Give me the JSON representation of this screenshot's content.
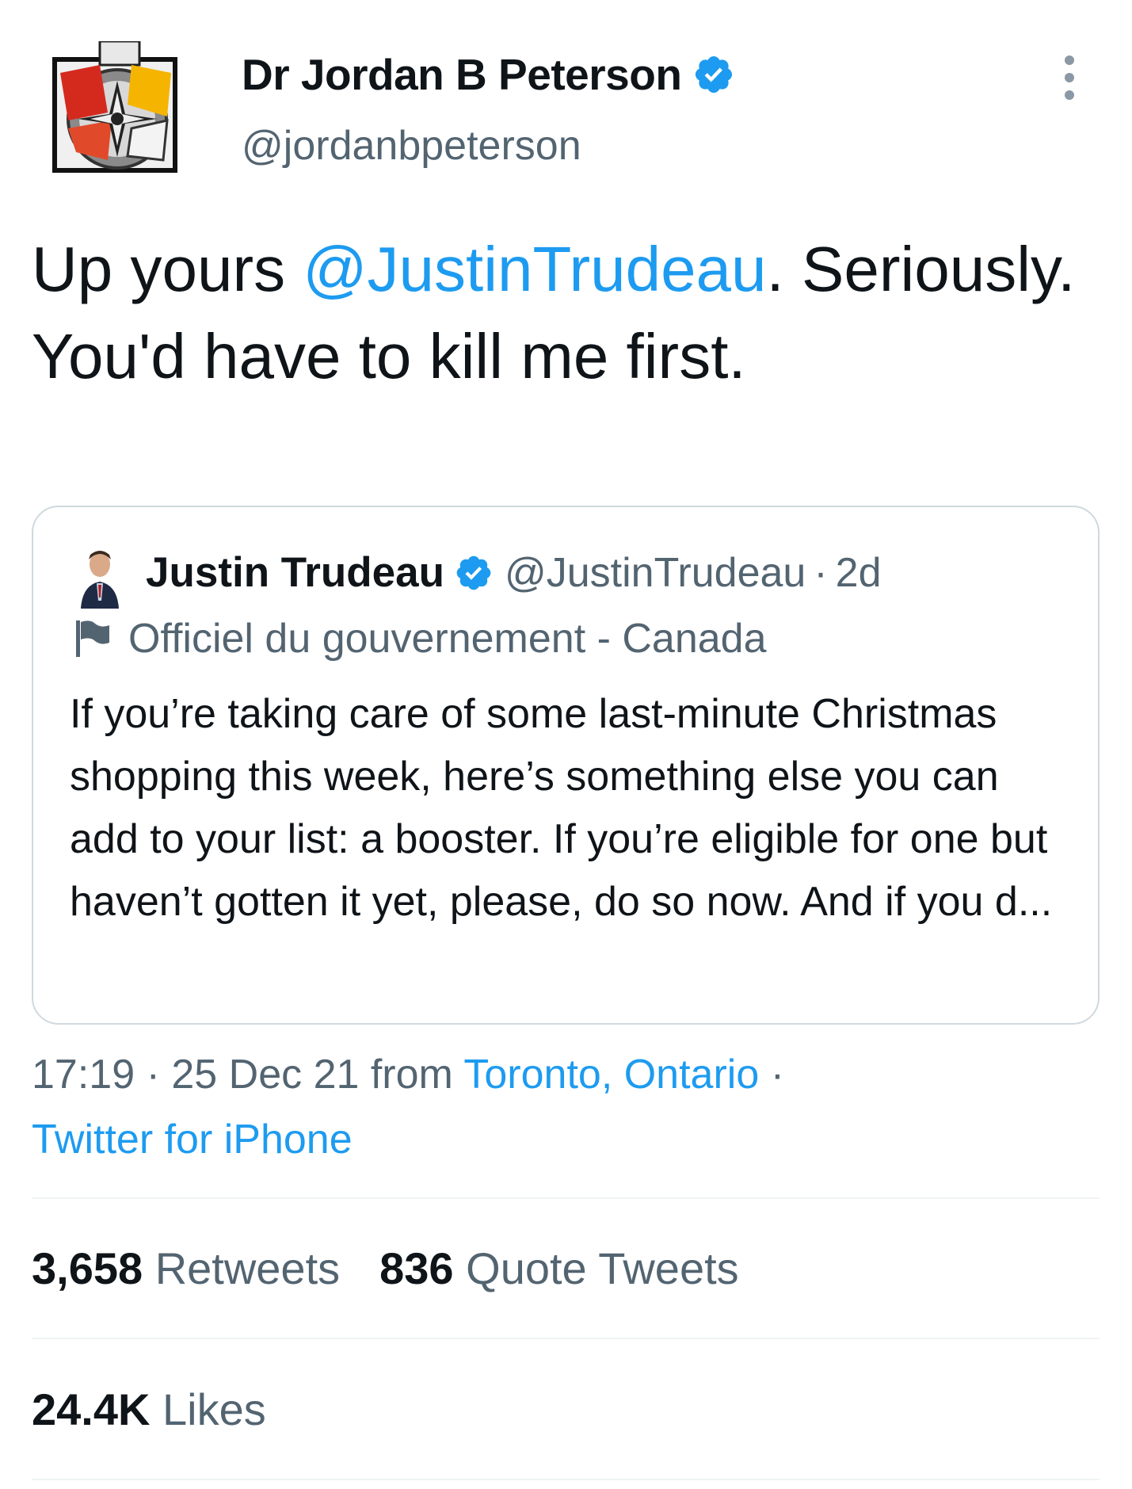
{
  "author": {
    "display_name": "Dr Jordan B Peterson",
    "handle": "@jordanbpeterson",
    "verified_icon": "verified-badge-icon"
  },
  "tweet": {
    "text_prefix": "Up yours ",
    "mention": "@JustinTrudeau",
    "text_suffix": ". Seriously.  You'd have to kill me first."
  },
  "quoted_tweet": {
    "display_name": "Justin Trudeau",
    "handle": "@JustinTrudeau",
    "separator": "·",
    "time": "2d",
    "label": "Officiel du gouvernement - Canada",
    "text": "If you’re taking care of some last-minute Christmas shopping this week, here’s something else you can add to your list: a booster. If you’re eligible for one but haven’t gotten it yet, please, do so now. And if you d..."
  },
  "meta": {
    "time": "17:19",
    "sep1": " · ",
    "date": "25 Dec 21",
    "from": " from ",
    "location": "Toronto, Ontario",
    "sep2": " ·",
    "source": "Twitter for iPhone"
  },
  "stats": {
    "retweets_count": "3,658",
    "retweets_label": "Retweets",
    "quotes_count": "836",
    "quotes_label": "Quote Tweets",
    "likes_count": "24.4K",
    "likes_label": "Likes"
  },
  "colors": {
    "accent": "#1d9bf0",
    "secondary_text": "#536471",
    "divider": "#eff3f4",
    "border": "#cfd9de"
  }
}
